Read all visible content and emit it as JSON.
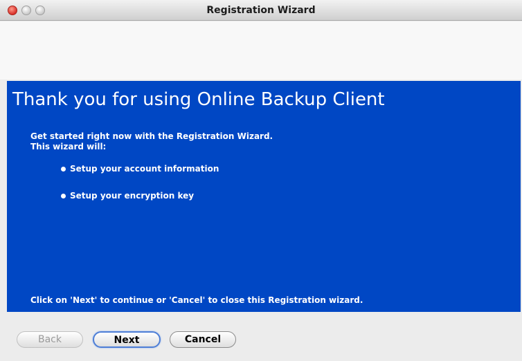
{
  "window": {
    "title": "Registration Wizard"
  },
  "banner": {
    "headline": "Thank you for using Online Backup Client",
    "intro_line1": "Get started right now with the Registration Wizard.",
    "intro_line2": "This wizard will:",
    "bullets": [
      "Setup your account information",
      "Setup your encryption key"
    ],
    "footer": "Click on 'Next' to continue or 'Cancel' to close this Registration wizard."
  },
  "buttons": {
    "back": "Back",
    "next": "Next",
    "cancel": "Cancel"
  },
  "colors": {
    "banner_bg": "#0047c4",
    "banner_text": "#ffffff"
  }
}
